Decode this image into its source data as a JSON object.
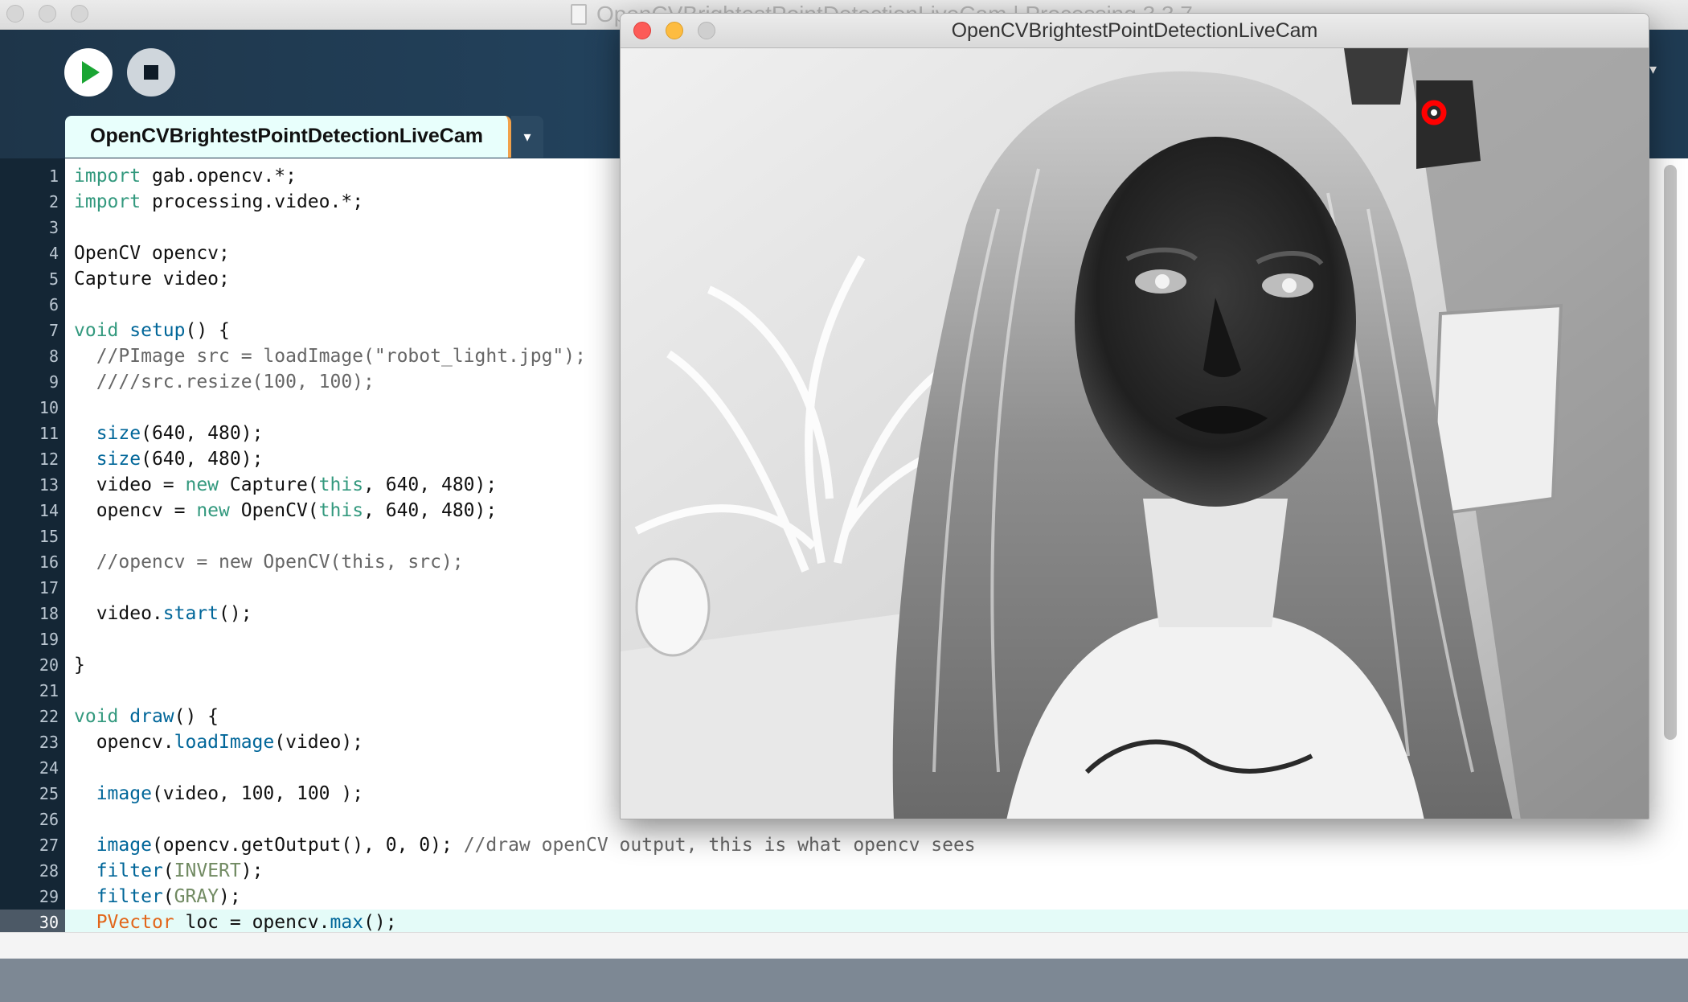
{
  "ide": {
    "window_title": "OpenCVBrightestPointDetectionLiveCam | Processing 3.3.7",
    "tab_label": "OpenCVBrightestPointDetectionLiveCam",
    "tab_menu": "▾",
    "mode_arrow": "▾"
  },
  "editor": {
    "current_line": 30,
    "lines": [
      {
        "n": "1",
        "segs": [
          {
            "t": "import",
            "c": "kw"
          },
          {
            "t": " gab.opencv.*;"
          }
        ]
      },
      {
        "n": "2",
        "segs": [
          {
            "t": "import",
            "c": "kw"
          },
          {
            "t": " processing.video.*;"
          }
        ]
      },
      {
        "n": "3",
        "segs": []
      },
      {
        "n": "4",
        "segs": [
          {
            "t": "OpenCV opencv;"
          }
        ]
      },
      {
        "n": "5",
        "segs": [
          {
            "t": "Capture video;"
          }
        ]
      },
      {
        "n": "6",
        "segs": []
      },
      {
        "n": "7",
        "segs": [
          {
            "t": "void",
            "c": "kw"
          },
          {
            "t": " "
          },
          {
            "t": "setup",
            "c": "fn"
          },
          {
            "t": "() {"
          }
        ]
      },
      {
        "n": "8",
        "segs": [
          {
            "t": "  //PImage src = loadImage(\"robot_light.jpg\");",
            "c": "cm"
          }
        ]
      },
      {
        "n": "9",
        "segs": [
          {
            "t": "  ////src.resize(100, 100);",
            "c": "cm"
          }
        ]
      },
      {
        "n": "10",
        "segs": []
      },
      {
        "n": "11",
        "segs": [
          {
            "t": "  "
          },
          {
            "t": "size",
            "c": "api"
          },
          {
            "t": "(640, 480);"
          }
        ]
      },
      {
        "n": "12",
        "segs": [
          {
            "t": "  "
          },
          {
            "t": "size",
            "c": "api"
          },
          {
            "t": "(640, 480);"
          }
        ]
      },
      {
        "n": "13",
        "segs": [
          {
            "t": "  video = "
          },
          {
            "t": "new",
            "c": "kw2"
          },
          {
            "t": " Capture("
          },
          {
            "t": "this",
            "c": "kw2"
          },
          {
            "t": ", 640, 480);"
          }
        ]
      },
      {
        "n": "14",
        "segs": [
          {
            "t": "  opencv = "
          },
          {
            "t": "new",
            "c": "kw2"
          },
          {
            "t": " OpenCV("
          },
          {
            "t": "this",
            "c": "kw2"
          },
          {
            "t": ", 640, 480);"
          }
        ]
      },
      {
        "n": "15",
        "segs": []
      },
      {
        "n": "16",
        "segs": [
          {
            "t": "  //opencv = new OpenCV(this, src);",
            "c": "cm"
          }
        ]
      },
      {
        "n": "17",
        "segs": []
      },
      {
        "n": "18",
        "segs": [
          {
            "t": "  video."
          },
          {
            "t": "start",
            "c": "api"
          },
          {
            "t": "();"
          }
        ]
      },
      {
        "n": "19",
        "segs": []
      },
      {
        "n": "20",
        "segs": [
          {
            "t": "}"
          }
        ]
      },
      {
        "n": "21",
        "segs": []
      },
      {
        "n": "22",
        "segs": [
          {
            "t": "void",
            "c": "kw"
          },
          {
            "t": " "
          },
          {
            "t": "draw",
            "c": "fn"
          },
          {
            "t": "() {"
          }
        ]
      },
      {
        "n": "23",
        "segs": [
          {
            "t": "  opencv."
          },
          {
            "t": "loadImage",
            "c": "api"
          },
          {
            "t": "(video);"
          }
        ]
      },
      {
        "n": "24",
        "segs": []
      },
      {
        "n": "25",
        "segs": [
          {
            "t": "  "
          },
          {
            "t": "image",
            "c": "api"
          },
          {
            "t": "(video, 100, 100 );"
          }
        ]
      },
      {
        "n": "26",
        "segs": []
      },
      {
        "n": "27",
        "segs": [
          {
            "t": "  "
          },
          {
            "t": "image",
            "c": "api"
          },
          {
            "t": "(opencv.getOutput(), 0, 0); "
          },
          {
            "t": "//draw openCV output, this is what opencv sees",
            "c": "cm"
          }
        ]
      },
      {
        "n": "28",
        "segs": [
          {
            "t": "  "
          },
          {
            "t": "filter",
            "c": "api"
          },
          {
            "t": "("
          },
          {
            "t": "INVERT",
            "c": "const"
          },
          {
            "t": ");"
          }
        ]
      },
      {
        "n": "29",
        "segs": [
          {
            "t": "  "
          },
          {
            "t": "filter",
            "c": "api"
          },
          {
            "t": "("
          },
          {
            "t": "GRAY",
            "c": "const"
          },
          {
            "t": ");"
          }
        ]
      },
      {
        "n": "30",
        "segs": [
          {
            "t": "  "
          },
          {
            "t": "PVector",
            "c": "type"
          },
          {
            "t": " loc = opencv."
          },
          {
            "t": "max",
            "c": "api"
          },
          {
            "t": "();"
          }
        ]
      }
    ]
  },
  "sketch": {
    "title": "OpenCVBrightestPointDetectionLiveCam"
  },
  "colors": {
    "kw": "#33997e",
    "kw2": "#33997e",
    "fn": "#006699",
    "api": "#006699",
    "cm": "#666666",
    "const": "#718a62",
    "type": "#e2661a",
    "marker": "#ff0000"
  },
  "icons": [
    "play-icon",
    "stop-icon",
    "dropdown-arrow-icon",
    "document-icon"
  ]
}
